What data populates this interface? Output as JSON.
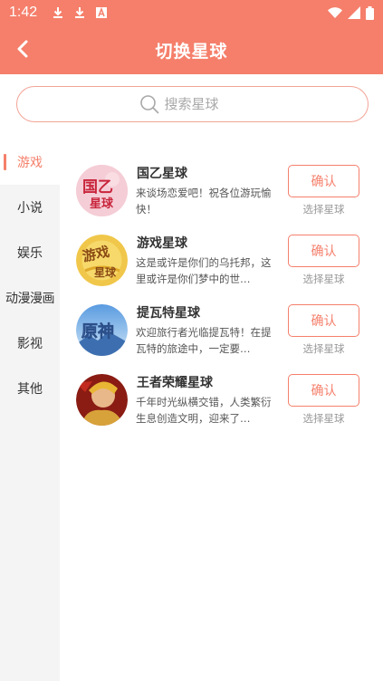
{
  "status_bar": {
    "time": "1:42",
    "icons_left": [
      "download-icon",
      "download-icon",
      "font-a-icon"
    ],
    "icons_right": [
      "wifi-icon",
      "signal-icon",
      "battery-icon"
    ]
  },
  "header": {
    "title": "切换星球",
    "back_icon": "back-arrow-icon",
    "background": "#f57f6b"
  },
  "search": {
    "placeholder": "搜索星球",
    "icon": "search-icon"
  },
  "sidebar": {
    "items": [
      {
        "label": "游戏",
        "active": true
      },
      {
        "label": "小说",
        "active": false
      },
      {
        "label": "娱乐",
        "active": false
      },
      {
        "label": "动漫漫画",
        "active": false
      },
      {
        "label": "影视",
        "active": false
      },
      {
        "label": "其他",
        "active": false
      }
    ]
  },
  "planets": [
    {
      "name": "国乙星球",
      "desc": "来谈场恋爱吧！祝各位游玩愉快！",
      "button": "确认",
      "hint": "选择星球",
      "avatar_text": "国乙 星球"
    },
    {
      "name": "游戏星球",
      "desc": "这是或许是你们的乌托邦，这里或许是你们梦中的世…",
      "button": "确认",
      "hint": "选择星球",
      "avatar_text": "游戏 星球"
    },
    {
      "name": "提瓦特星球",
      "desc": "欢迎旅行者光临提瓦特！在提瓦特的旅途中，一定要…",
      "button": "确认",
      "hint": "选择星球",
      "avatar_text": "原神"
    },
    {
      "name": "王者荣耀星球",
      "desc": "千年时光纵横交错，人类繁衍生息创造文明，迎来了…",
      "button": "确认",
      "hint": "选择星球",
      "avatar_text": ""
    }
  ],
  "colors": {
    "accent": "#f57f6b",
    "sidebar_bg": "#f4f4f4"
  }
}
